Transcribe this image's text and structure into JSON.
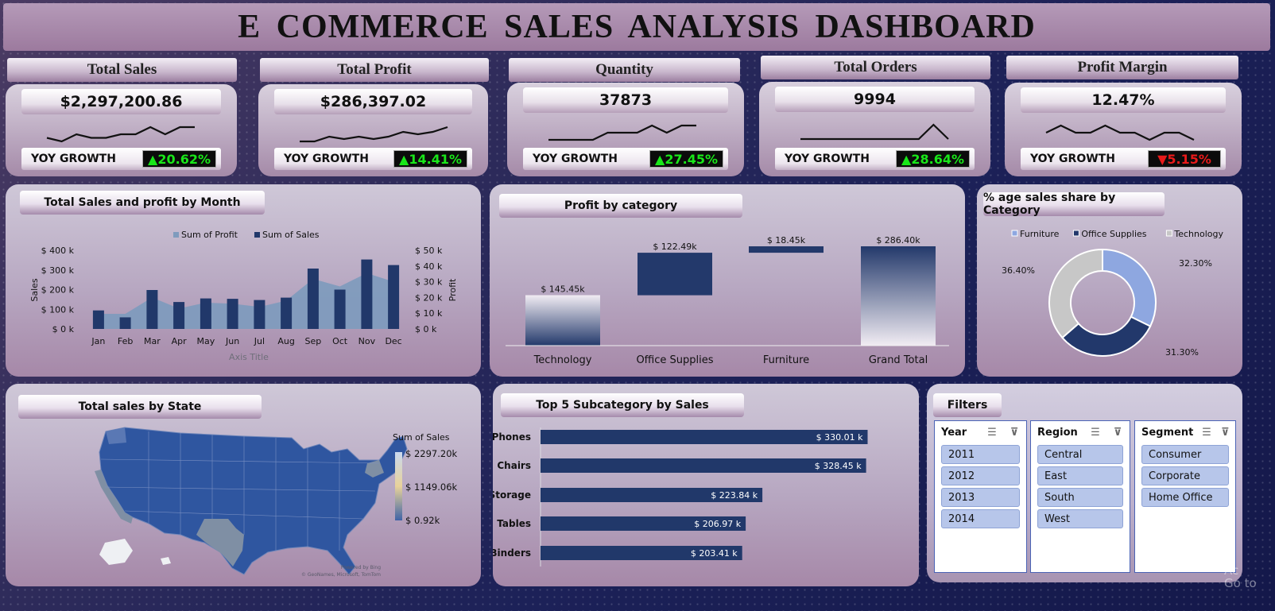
{
  "header": {
    "title": "E COMMERCE  SALES ANALYSIS  DASHBOARD"
  },
  "kpis": [
    {
      "label": "Total Sales",
      "value": "$2,297,200.86",
      "yoy_label": "YOY GROWTH",
      "yoy_value": "▲20.62%",
      "trend": "up",
      "spark": [
        3,
        2,
        4,
        3,
        3,
        4,
        4,
        6,
        4,
        6,
        6
      ]
    },
    {
      "label": "Total Profit",
      "value": "$286,397.02",
      "yoy_label": "YOY GROWTH",
      "yoy_value": "▲14.41%",
      "trend": "up",
      "spark": [
        2,
        2,
        4,
        3,
        4,
        3,
        4,
        6,
        5,
        6,
        8
      ]
    },
    {
      "label": "Quantity",
      "value": "37873",
      "yoy_label": "YOY GROWTH",
      "yoy_value": "▲27.45%",
      "trend": "up",
      "spark": [
        2,
        2,
        2,
        2,
        3,
        3,
        3,
        4,
        3,
        4,
        4
      ]
    },
    {
      "label": "Total Orders",
      "value": "9994",
      "yoy_label": "YOY GROWTH",
      "yoy_value": "▲28.64%",
      "trend": "up",
      "spark": [
        3,
        3,
        3,
        3,
        3,
        3,
        3,
        3,
        3,
        3.5,
        3
      ]
    },
    {
      "label": "Profit Margin",
      "value": "12.47%",
      "yoy_label": "YOY GROWTH",
      "yoy_value": "▼5.15%",
      "trend": "down",
      "spark": [
        3,
        4,
        3,
        3,
        4,
        3,
        3,
        2,
        3,
        3,
        2
      ]
    }
  ],
  "colors": {
    "up": "#19e619",
    "down": "#e81a1a",
    "sales_bar": "#21386a",
    "profit_area": "#7f9bbd",
    "map_fill": "#2f56a0",
    "map_light": "#7f8fa4"
  },
  "charts": {
    "monthly": {
      "title": "Total Sales and profit by Month",
      "legend_profit": "Sum of Profit",
      "legend_sales": "Sum of Sales",
      "ylabel_left": "Sales",
      "ylabel_right": "Profit",
      "xlabel": "Axis Title"
    },
    "profit_category": {
      "title": "Profit by category"
    },
    "share": {
      "title": "% age sales share by Category"
    },
    "subcategory": {
      "title": "Top 5 Subcategory by Sales"
    },
    "map": {
      "title": "Total sales by State",
      "legend_title": "Sum of Sales",
      "legend_max": "$ 2297.20k",
      "legend_mid": "$ 1149.06k",
      "legend_min": "$ 0.92k",
      "credit_1": "Powered by Bing",
      "credit_2": "© GeoNames, Microsoft, TomTom"
    }
  },
  "chart_data": [
    {
      "type": "bar",
      "title": "Total Sales and profit by Month",
      "categories": [
        "Jan",
        "Feb",
        "Mar",
        "Apr",
        "May",
        "Jun",
        "Jul",
        "Aug",
        "Sep",
        "Oct",
        "Nov",
        "Dec"
      ],
      "series": [
        {
          "name": "Sum of Sales",
          "axis": "left",
          "type": "bar",
          "values": [
            94,
            59,
            198,
            137,
            155,
            153,
            147,
            159,
            307,
            200,
            353,
            325
          ]
        },
        {
          "name": "Sum of Profit",
          "axis": "right",
          "type": "area",
          "values": [
            9.6,
            9.6,
            20,
            13,
            16.7,
            16,
            14,
            18,
            31.8,
            27,
            35.5,
            30
          ]
        }
      ],
      "units": "$ k",
      "xlabel": "Axis Title",
      "ylabel": "Sales",
      "y2label": "Profit",
      "ylim": [
        0,
        400
      ],
      "y2lim": [
        0,
        50
      ],
      "yticks": [
        "$ 0 k",
        "$ 100 k",
        "$ 200 k",
        "$ 300 k",
        "$ 400 k"
      ],
      "y2ticks": [
        "$ 0 k",
        "$ 10 k",
        "$ 20 k",
        "$ 30 k",
        "$ 40 k",
        "$ 50 k"
      ],
      "legend": "top"
    },
    {
      "type": "bar",
      "subtype": "waterfall",
      "title": "Profit by category",
      "categories": [
        "Technology",
        "Office Supplies",
        "Furniture",
        "Grand Total"
      ],
      "values": [
        145.45,
        122.49,
        18.45,
        286.4
      ],
      "labels": [
        "$ 145.45k",
        "$ 122.49k",
        "$ 18.45k",
        "$ 286.40k"
      ],
      "ylim": [
        0,
        300
      ]
    },
    {
      "type": "pie",
      "subtype": "donut",
      "title": "% age sales share by Category",
      "labels": [
        "Furniture",
        "Office Supplies",
        "Technology"
      ],
      "values": [
        32.3,
        31.3,
        36.4
      ],
      "value_labels": [
        "32.30%",
        "31.30%",
        "36.40%"
      ],
      "colors": [
        "#8ea7e0",
        "#22386b",
        "#c7c7c7"
      ],
      "legend": "top"
    },
    {
      "type": "bar",
      "orientation": "horizontal",
      "title": "Top 5 Subcategory by Sales",
      "categories": [
        "Phones",
        "Chairs",
        "Storage",
        "Tables",
        "Binders"
      ],
      "values": [
        330.01,
        328.45,
        223.84,
        206.97,
        203.41
      ],
      "labels": [
        "$ 330.01 k",
        "$ 328.45 k",
        "$ 223.84 k",
        "$ 206.97 k",
        "$ 203.41 k"
      ],
      "xlim": [
        0,
        340
      ]
    }
  ],
  "filters": {
    "title": "Filters",
    "slicers": [
      {
        "name": "Year",
        "items": [
          "2011",
          "2012",
          "2013",
          "2014"
        ]
      },
      {
        "name": "Region",
        "items": [
          "Central",
          "East",
          "South",
          "West"
        ]
      },
      {
        "name": "Segment",
        "items": [
          "Consumer",
          "Corporate",
          "Home Office"
        ]
      }
    ]
  },
  "watermark": {
    "line1": "Ac",
    "line2": "Go to"
  }
}
